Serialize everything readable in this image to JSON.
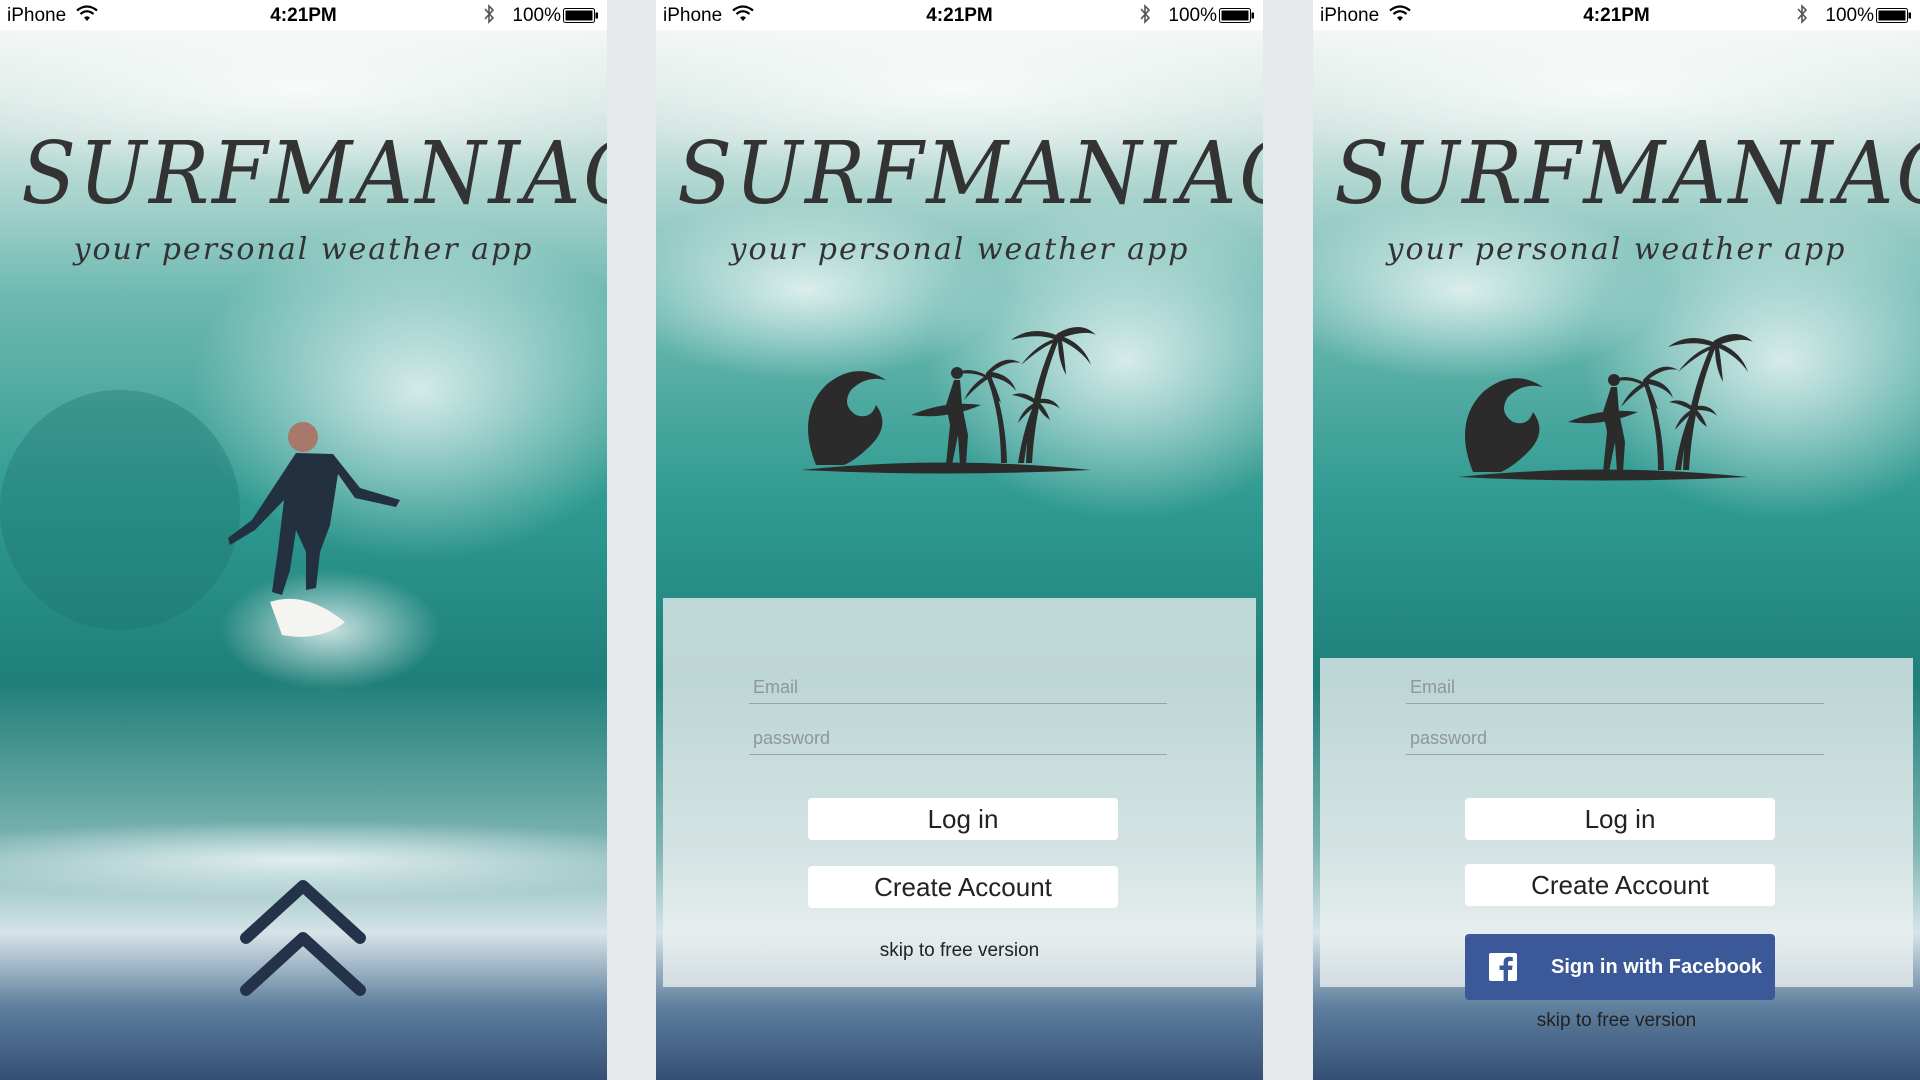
{
  "status_bar": {
    "carrier": "iPhone",
    "time": "4:21PM",
    "battery": "100%"
  },
  "branding": {
    "title": "SURFMANIAC",
    "tagline": "your personal weather app"
  },
  "login": {
    "email_placeholder": "Email",
    "password_placeholder": "password",
    "login_label": "Log in",
    "create_account_label": "Create Account",
    "facebook_label": "Sign in with Facebook",
    "skip_label": "skip to free version"
  },
  "colors": {
    "facebook_blue": "#3b5998",
    "logo_text": "#333333",
    "wave_teal": "#2f8f89"
  },
  "icons": [
    "wifi-icon",
    "bluetooth-icon",
    "battery-icon",
    "chevron-up-icon",
    "facebook-icon",
    "surf-emblem"
  ]
}
